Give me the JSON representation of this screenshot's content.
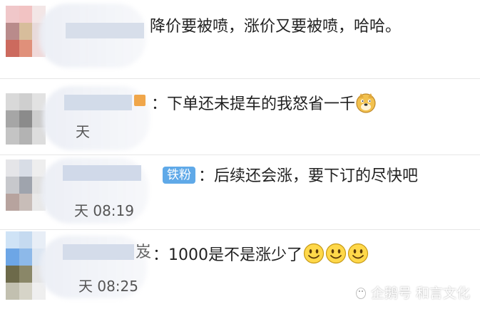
{
  "comments": [
    {
      "text": "降价要被喷，涨价又要被喷，哈哈。",
      "time": "",
      "badge": ""
    },
    {
      "text": "：下单还未提车的我怒省一千",
      "time": "",
      "badge": ""
    },
    {
      "text": "：后续还会涨，要下订的尽快吧",
      "time": "今天 08:19",
      "badge": "铁粉"
    },
    {
      "text": "：1000是不是涨少了",
      "time": "今天 08:25",
      "badge": ""
    }
  ],
  "partial": {
    "c2_time_frag": "天",
    "c3_time_frag": "天 08:19",
    "c4_name_frag": "岌",
    "c4_time_frag": "天 08:25"
  },
  "emoji": {
    "doge": "doge-icon",
    "smiley": "smiley-icon"
  },
  "watermark": "企鹅号 和言文化",
  "colors": {
    "badge": "#5fa9e8",
    "separator": "#e6e6e6",
    "text": "#222222",
    "time": "#555555"
  }
}
